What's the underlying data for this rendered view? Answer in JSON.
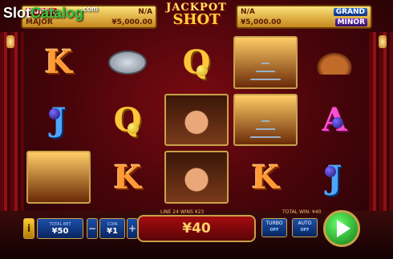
{
  "watermark": {
    "slot": "Slot",
    "catalog": "Catalog",
    "com": ".com"
  },
  "jackpots": {
    "super": {
      "label": "SUPER",
      "value": "N/A"
    },
    "major": {
      "label": "MAJOR",
      "value": "¥5,000.00"
    },
    "grand": {
      "label": "GRAND",
      "value": "N/A"
    },
    "minor": {
      "label": "MINOR",
      "value": "¥5,000.00"
    }
  },
  "logo": {
    "line1": "JACKPOT",
    "line2": "SHOT"
  },
  "reels": [
    [
      "K",
      "J",
      "mine"
    ],
    [
      "pan",
      "Q",
      "K"
    ],
    [
      "Q",
      "cowboy",
      "cowboy"
    ],
    [
      "rail",
      "rail",
      "K"
    ],
    [
      "hat",
      "A",
      "J"
    ]
  ],
  "status": {
    "lines_wins": "LINE 24 WINS ¥23",
    "total_win": "TOTAL WIN: ¥40"
  },
  "controls": {
    "info": "i",
    "total_bet_label": "TOTAL BET",
    "total_bet": "¥50",
    "minus": "−",
    "coin_label": "COIN",
    "coin": "¥1",
    "plus": "+",
    "win_amount": "¥40",
    "turbo_label": "TURBO",
    "turbo_state": "OFF",
    "auto_label": "AUTO",
    "auto_state": "OFF"
  }
}
